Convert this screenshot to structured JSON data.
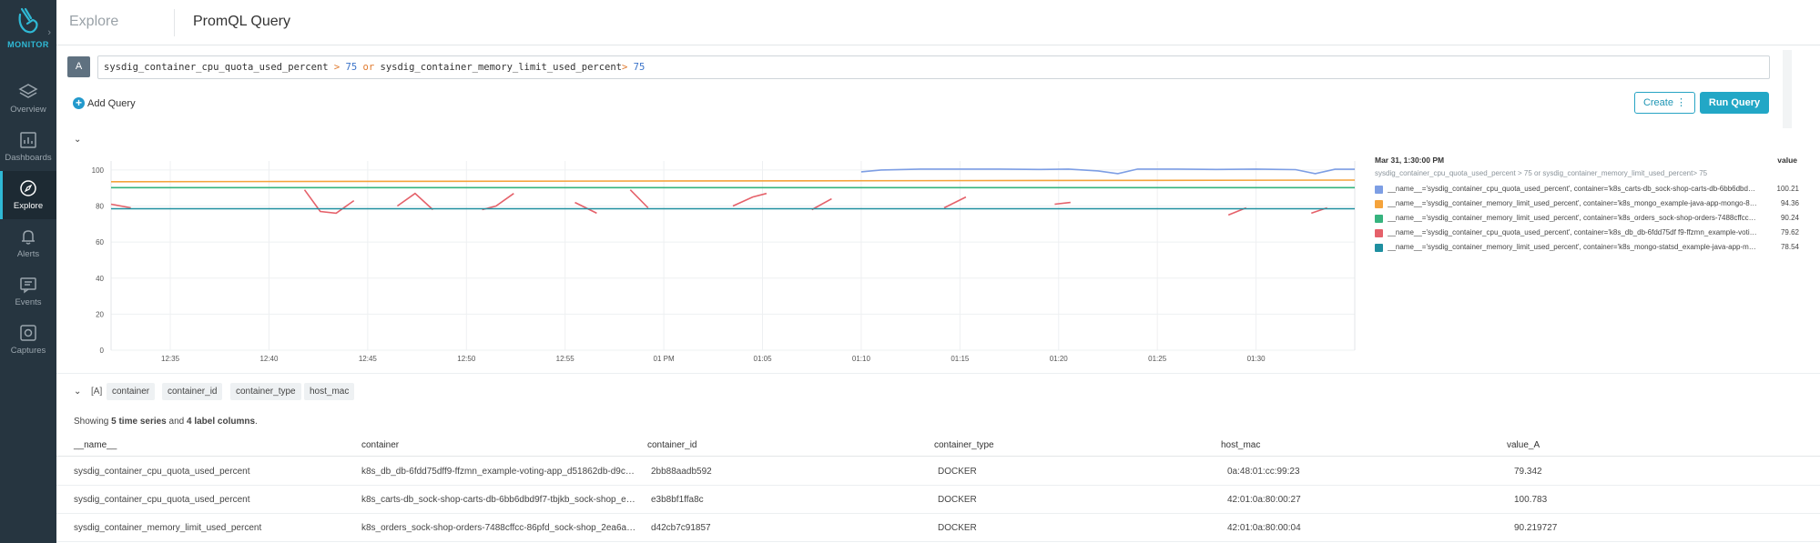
{
  "app": {
    "brand": "MONITOR",
    "accent": "#2fb9d5",
    "sidebar_bg": "#263540"
  },
  "sidebar": {
    "items": [
      {
        "label": "Overview",
        "icon": "layers-icon"
      },
      {
        "label": "Dashboards",
        "icon": "dashboard-icon"
      },
      {
        "label": "Explore",
        "icon": "compass-icon",
        "active": true
      },
      {
        "label": "Alerts",
        "icon": "bell-icon"
      },
      {
        "label": "Events",
        "icon": "events-icon"
      },
      {
        "label": "Captures",
        "icon": "capture-icon"
      }
    ]
  },
  "header": {
    "root": "Explore",
    "title": "PromQL Query"
  },
  "query": {
    "badge": "A",
    "part1": "sysdig_container_cpu_quota_used_percent",
    "op1": ">",
    "num1": "75",
    "or": "or",
    "part2": "sysdig_container_memory_limit_used_percent",
    "op2": ">",
    "num2": "75"
  },
  "actions": {
    "add_query": "Add Query",
    "create": "Create",
    "run": "Run Query"
  },
  "chart_data": {
    "type": "line",
    "title": "",
    "xlabel": "",
    "ylabel": "",
    "ylim": [
      0,
      105
    ],
    "y_ticks": [
      "0",
      "20",
      "40",
      "60",
      "80",
      "100"
    ],
    "x_ticks": [
      "12:35",
      "12:40",
      "12:45",
      "12:50",
      "12:55",
      "01 PM",
      "01:05",
      "01:10",
      "01:15",
      "01:20",
      "01:25",
      "01:30"
    ],
    "x_range_minutes": [
      0,
      63
    ],
    "grid": true,
    "series": [
      {
        "color": "#7d9ee4",
        "points": [
          [
            38,
            99
          ],
          [
            39,
            100
          ],
          [
            41,
            100.5
          ],
          [
            43,
            100.5
          ],
          [
            45,
            100.5
          ],
          [
            47,
            100.3
          ],
          [
            48.5,
            100.5
          ],
          [
            50,
            99.5
          ],
          [
            51,
            98
          ],
          [
            52,
            100.5
          ],
          [
            54,
            100.5
          ],
          [
            56,
            100.3
          ],
          [
            58,
            100.5
          ],
          [
            60,
            100.2
          ],
          [
            61,
            98
          ],
          [
            62,
            100.4
          ],
          [
            63,
            100.4
          ]
        ]
      },
      {
        "color": "#f5a33b",
        "points": [
          [
            0,
            93.5
          ],
          [
            63,
            94.4
          ]
        ]
      },
      {
        "color": "#36b37e",
        "points": [
          [
            0,
            90.2
          ],
          [
            63,
            90.2
          ]
        ]
      },
      {
        "color": "#e5616a",
        "segments": [
          [
            [
              0,
              81
            ],
            [
              1,
              79
            ]
          ],
          [
            [
              9.8,
              89
            ],
            [
              10.6,
              77
            ],
            [
              11.4,
              76
            ],
            [
              12.3,
              83
            ]
          ],
          [
            [
              14.5,
              80
            ],
            [
              15.4,
              87
            ],
            [
              16.3,
              78
            ]
          ],
          [
            [
              18.8,
              78
            ],
            [
              19.5,
              80
            ],
            [
              20.4,
              87
            ]
          ],
          [
            [
              23.5,
              82
            ],
            [
              24.6,
              76
            ]
          ],
          [
            [
              26.3,
              89
            ],
            [
              27.2,
              79
            ]
          ],
          [
            [
              31.5,
              80
            ],
            [
              32.5,
              85
            ],
            [
              33.2,
              87
            ]
          ],
          [
            [
              35.5,
              78
            ],
            [
              36.5,
              84
            ]
          ],
          [
            [
              42.2,
              79
            ],
            [
              43.3,
              85
            ]
          ],
          [
            [
              47.8,
              81
            ],
            [
              48.6,
              82
            ]
          ],
          [
            [
              56.6,
              75
            ],
            [
              57.5,
              79
            ]
          ],
          [
            [
              60.8,
              76
            ],
            [
              61.6,
              79
            ]
          ]
        ]
      },
      {
        "color": "#1f8fa0",
        "points": [
          [
            0,
            78.5
          ],
          [
            63,
            78.5
          ]
        ]
      }
    ]
  },
  "legend": {
    "time": "Mar 31, 1:30:00 PM",
    "value_header": "value",
    "query": "sysdig_container_cpu_quota_used_percent > 75 or sysdig_container_memory_limit_used_percent> 75",
    "rows": [
      {
        "color": "#7d9ee4",
        "label": "__name__='sysdig_container_cpu_quota_used_percent', container='k8s_carts-db_sock-shop-carts-db-6bb6dbd…",
        "value": "100.21"
      },
      {
        "color": "#f5a33b",
        "label": "__name__='sysdig_container_memory_limit_used_percent', container='k8s_mongo_example-java-app-mongo-8…",
        "value": "94.36"
      },
      {
        "color": "#36b37e",
        "label": "__name__='sysdig_container_memory_limit_used_percent', container='k8s_orders_sock-shop-orders-7488cffcc…",
        "value": "90.24"
      },
      {
        "color": "#e5616a",
        "label": "__name__='sysdig_container_cpu_quota_used_percent', container='k8s_db_db-6fdd75df f9-ffzmn_example-voti…",
        "value": "79.62"
      },
      {
        "color": "#1f8fa0",
        "label": "__name__='sysdig_container_memory_limit_used_percent', container='k8s_mongo-statsd_example-java-app-m…",
        "value": "78.54"
      }
    ]
  },
  "labels": {
    "tag": "[A]",
    "pills": [
      "container",
      "container_id",
      "container_type",
      "host_mac"
    ]
  },
  "summary": {
    "prefix": "Showing",
    "series_count": "5 time series",
    "mid": "and",
    "label_count": "4 label columns",
    "suffix": "."
  },
  "table": {
    "columns": [
      "__name__",
      "container",
      "container_id",
      "container_type",
      "host_mac",
      "value_A"
    ],
    "rows": [
      [
        "sysdig_container_cpu_quota_used_percent",
        "k8s_db_db-6fdd75dff9-ffzmn_example-voting-app_d51862db-d9c5…",
        "2bb88aadb592",
        "DOCKER",
        "0a:48:01:cc:99:23",
        "79.342"
      ],
      [
        "sysdig_container_cpu_quota_used_percent",
        "k8s_carts-db_sock-shop-carts-db-6bb6dbd9f7-tbjkb_sock-shop_e6…",
        "e3b8bf1ffa8c",
        "DOCKER",
        "42:01:0a:80:00:27",
        "100.783"
      ],
      [
        "sysdig_container_memory_limit_used_percent",
        "k8s_orders_sock-shop-orders-7488cffcc-86pfd_sock-shop_2ea6a9…",
        "d42cb7c91857",
        "DOCKER",
        "42:01:0a:80:00:04",
        "90.219727"
      ]
    ]
  }
}
